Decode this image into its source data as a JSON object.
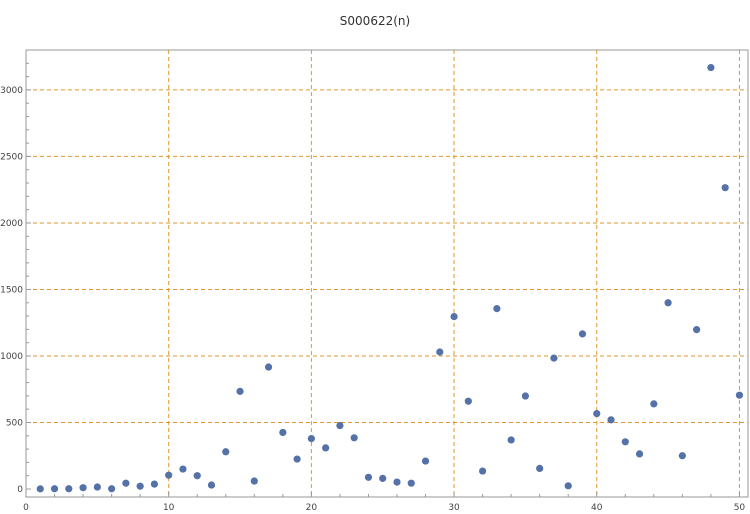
{
  "chart_data": {
    "type": "scatter",
    "title": "S000622(n)",
    "xlabel": "",
    "ylabel": "",
    "xlim": [
      0,
      50.6
    ],
    "ylim": [
      -60,
      3300
    ],
    "x_ticks": [
      0,
      10,
      20,
      30,
      40,
      50
    ],
    "y_ticks": [
      0,
      500,
      1000,
      1500,
      2000,
      2500,
      3000
    ],
    "grid": true,
    "point_color": "#5471a8",
    "grid_color": "#e0962c",
    "series": [
      {
        "x": [
          1,
          2,
          3,
          4,
          5,
          6,
          7,
          8,
          9,
          10,
          11,
          12,
          13,
          14,
          15,
          16,
          17,
          18,
          19,
          20,
          21,
          22,
          23,
          24,
          25,
          26,
          27,
          28,
          29,
          30,
          31,
          32,
          33,
          34,
          35,
          36,
          37,
          38,
          39,
          40,
          41,
          42,
          43,
          44,
          45,
          46,
          47,
          48,
          49,
          50
        ],
        "y": [
          1,
          2,
          2,
          10,
          15,
          2,
          44,
          21,
          37,
          104,
          150,
          100,
          30,
          280,
          734,
          60,
          917,
          425,
          225,
          379,
          309,
          477,
          385,
          88,
          80,
          52,
          44,
          210,
          1030,
          1296,
          660,
          135,
          1356,
          369,
          699,
          155,
          984,
          24,
          1166,
          567,
          520,
          355,
          264,
          640,
          1400,
          250,
          1198,
          3168,
          2265,
          705
        ]
      }
    ]
  }
}
